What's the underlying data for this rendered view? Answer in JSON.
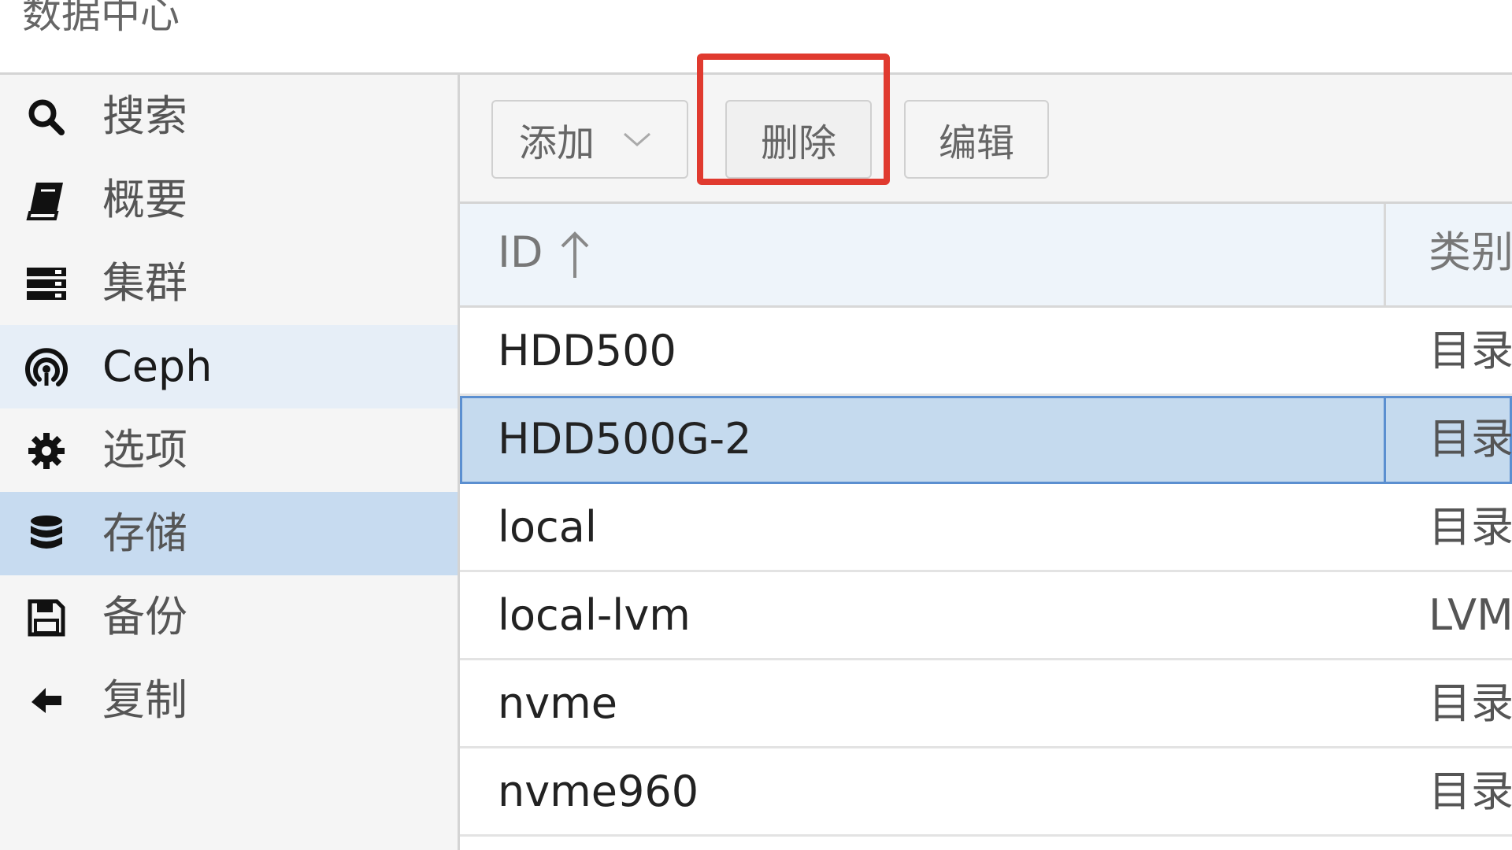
{
  "header": {
    "title": "数据中心"
  },
  "sidebar": {
    "items": [
      {
        "label": "搜索",
        "icon": "search-icon"
      },
      {
        "label": "概要",
        "icon": "book-icon"
      },
      {
        "label": "集群",
        "icon": "server-icon"
      },
      {
        "label": "Ceph",
        "icon": "ceph-icon"
      },
      {
        "label": "选项",
        "icon": "gear-icon"
      },
      {
        "label": "存储",
        "icon": "database-icon"
      },
      {
        "label": "备份",
        "icon": "floppy-icon"
      },
      {
        "label": "复制",
        "icon": "replication-icon"
      }
    ],
    "selected": "存储",
    "hovered": "Ceph"
  },
  "toolbar": {
    "add_label": "添加",
    "delete_label": "删除",
    "edit_label": "编辑"
  },
  "grid": {
    "columns": {
      "id": "ID",
      "type": "类别"
    },
    "rows": [
      {
        "id": "HDD500",
        "type": "目录"
      },
      {
        "id": "HDD500G-2",
        "type": "目录"
      },
      {
        "id": "local",
        "type": "目录"
      },
      {
        "id": "local-lvm",
        "type": "LVM"
      },
      {
        "id": "nvme",
        "type": "目录"
      },
      {
        "id": "nvme960",
        "type": "目录"
      }
    ],
    "selected_row": "HDD500G-2"
  },
  "colors": {
    "highlight_box": "#e03a2f",
    "selection": "#c5daee",
    "sidebar_selected": "#c7dbf0"
  }
}
